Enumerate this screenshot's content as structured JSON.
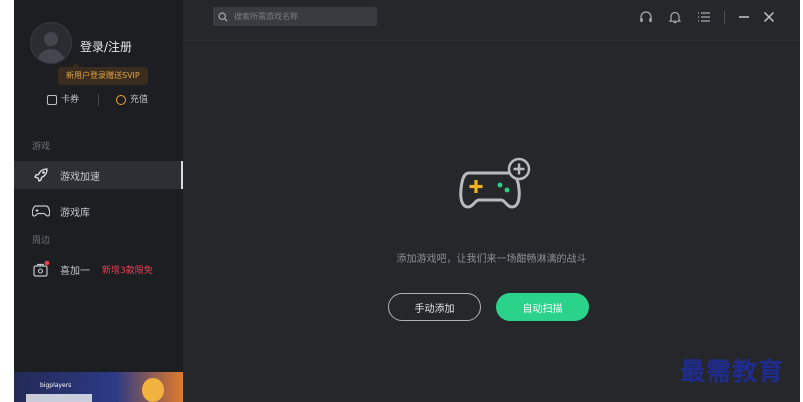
{
  "account": {
    "login_label": "登录/注册",
    "vip_promo": "新用户登录赠送SVIP",
    "card_label": "卡券",
    "recharge_label": "充值"
  },
  "sidebar": {
    "section_games": "游戏",
    "items": [
      {
        "label": "游戏加速",
        "icon": "rocket-icon",
        "active": true
      },
      {
        "label": "游戏库",
        "icon": "gamepad-icon",
        "active": false
      }
    ],
    "section_nearby": "周边",
    "extra_item": {
      "label": "喜加一",
      "badge": "新增3款限免",
      "icon": "gift-icon"
    },
    "banner": {
      "brand": "bigplayers"
    }
  },
  "search": {
    "placeholder": "搜索所需游戏名称"
  },
  "toolbar_icons": [
    "headset-icon",
    "bell-icon",
    "menu-icon",
    "minimize-icon",
    "close-icon"
  ],
  "main": {
    "empty_text": "添加游戏吧，让我们来一场酣畅淋漓的战斗",
    "manual_add": "手动添加",
    "auto_scan": "自动扫描"
  },
  "colors": {
    "accent_green": "#2bd38a",
    "vip_gold": "#e2a243",
    "promo_red": "#e8414f",
    "sidebar_bg": "#1d1e22",
    "main_bg": "#26272b"
  },
  "watermark": "最需教育"
}
